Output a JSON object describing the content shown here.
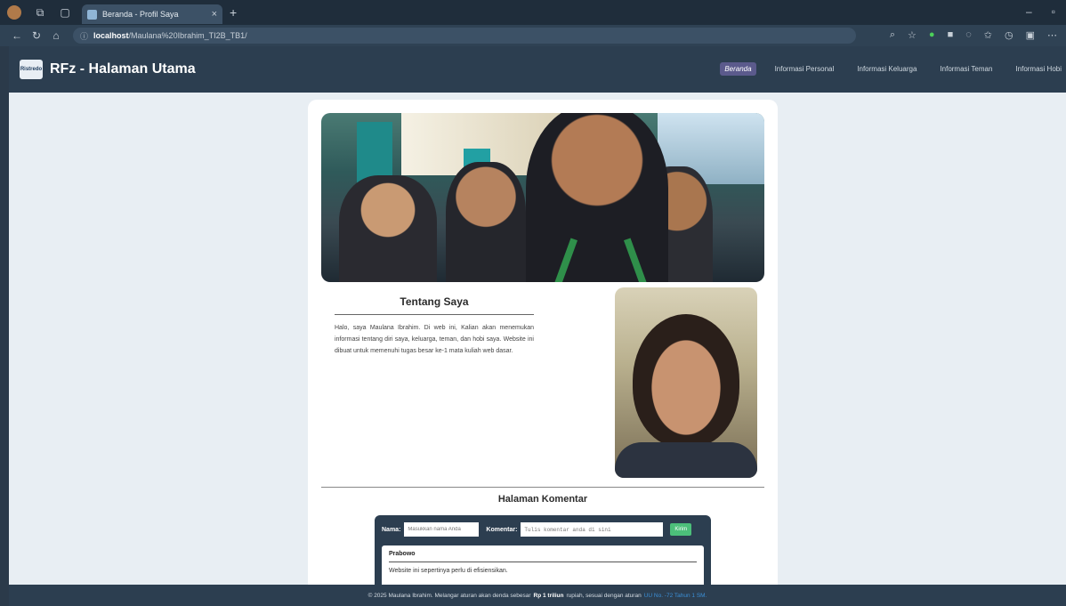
{
  "browser": {
    "tab_title": "Beranda - Profil Saya",
    "url_host": "localhost",
    "url_path": "/Maulana%20Ibrahim_TI2B_TB1/"
  },
  "header": {
    "logo_text": "Ristredo",
    "site_title": "RFz - Halaman Utama",
    "nav": [
      "Beranda",
      "Informasi Personal",
      "Informasi Keluarga",
      "Informasi Teman",
      "Informasi Hobi"
    ]
  },
  "about": {
    "title": "Tentang Saya",
    "text": "Halo, saya Maulana Ibrahim. Di web ini, Kalian akan menemukan informasi tentang diri saya, keluarga, teman, dan hobi saya. Website ini dibuat untuk memenuhi tugas besar ke-1 mata kuliah web dasar."
  },
  "comments": {
    "title": "Halaman Komentar",
    "name_label": "Nama:",
    "name_placeholder": "Masukkan nama Anda",
    "comment_label": "Komentar:",
    "comment_placeholder": "Tulis komentar anda di sini",
    "submit": "Kirim",
    "items": [
      {
        "author": "Prabowo",
        "text": "Website ini sepertinya perlu di efisiensikan."
      }
    ]
  },
  "footer": {
    "prefix": "© 2025 Maulana Ibrahim. Melangar aturan akan denda sebesar",
    "amount": "Rp 1 triliun",
    "middle": "rupiah, sesuai dengan aturan",
    "law": "UU No. -72 Tahun 1 SM."
  }
}
